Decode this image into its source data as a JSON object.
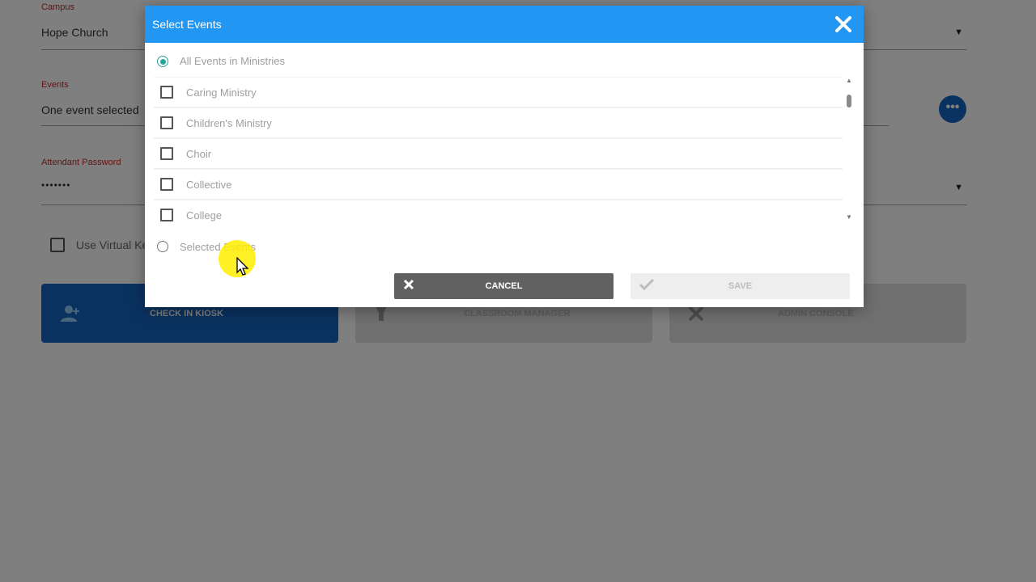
{
  "form": {
    "campus": {
      "label": "Campus",
      "value": "Hope Church"
    },
    "events": {
      "label": "Events",
      "value": "One event selected"
    },
    "password": {
      "label": "Attendant Password",
      "value": "•••••••"
    },
    "virtual_keyboard": {
      "label": "Use Virtual Ke",
      "checked": false
    },
    "more_icon": "more-horizontal-icon"
  },
  "mode_buttons": [
    {
      "label": "CHECK IN KIOSK",
      "icon": "add-user-icon"
    },
    {
      "label": "CLASSROOM MANAGER",
      "icon": "flashlight-icon"
    },
    {
      "label": "ADMIN CONSOLE",
      "icon": "tools-icon"
    }
  ],
  "dialog": {
    "title": "Select Events",
    "close_icon": "close-icon",
    "all_events_label": "All Events in Ministries",
    "all_events_checked": true,
    "items": [
      {
        "label": "Caring Ministry",
        "checked": false
      },
      {
        "label": "Children's Ministry",
        "checked": false
      },
      {
        "label": "Choir",
        "checked": false
      },
      {
        "label": "Collective",
        "checked": false
      },
      {
        "label": "College",
        "checked": false
      }
    ],
    "selected_events_label": "Selected Events",
    "selected_events_checked": false,
    "cancel_label": "CANCEL",
    "save_label": "SAVE"
  },
  "colors": {
    "header": "#2196f3",
    "primary": "#1565c0",
    "radio_active": "#26a69a",
    "required_label": "#c62828"
  }
}
